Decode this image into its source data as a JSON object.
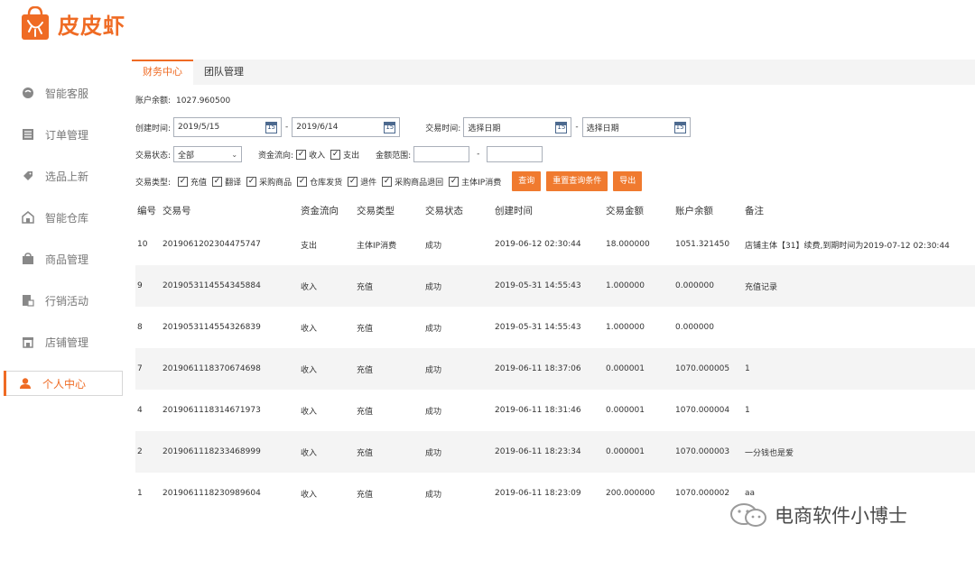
{
  "brand": {
    "name": "皮皮虾",
    "color": "#ef6b24"
  },
  "sidebar": {
    "items": [
      {
        "label": "智能客服",
        "icon": "chat-icon"
      },
      {
        "label": "订单管理",
        "icon": "list-icon"
      },
      {
        "label": "选品上新",
        "icon": "tag-icon"
      },
      {
        "label": "智能仓库",
        "icon": "warehouse-icon"
      },
      {
        "label": "商品管理",
        "icon": "bag-icon"
      },
      {
        "label": "行销活动",
        "icon": "activity-icon"
      },
      {
        "label": "店铺管理",
        "icon": "store-icon"
      },
      {
        "label": "个人中心",
        "icon": "user-icon",
        "active": true
      }
    ]
  },
  "tabs": [
    {
      "label": "财务中心",
      "active": true
    },
    {
      "label": "团队管理"
    }
  ],
  "account": {
    "label": "账户余额:",
    "value": "1027.960500"
  },
  "filters": {
    "created_label": "创建时间:",
    "created_from": "2019/5/15",
    "created_to": "2019/6/14",
    "trade_label": "交易时间:",
    "trade_from_placeholder": "选择日期",
    "trade_to_placeholder": "选择日期",
    "calendar_text": "15",
    "status_label": "交易状态:",
    "status_value": "全部",
    "flow_label": "资金流向:",
    "flow_in": "收入",
    "flow_out": "支出",
    "amount_label": "金额范围:",
    "dash": "-",
    "type_label": "交易类型:",
    "types": [
      "充值",
      "翻译",
      "采购商品",
      "仓库发货",
      "退件",
      "采购商品退回",
      "主体IP消费"
    ],
    "btn_query": "查询",
    "btn_reset": "重置查询条件",
    "btn_export": "导出"
  },
  "table": {
    "headers": [
      "编号",
      "交易号",
      "资金流向",
      "交易类型",
      "交易状态",
      "创建时间",
      "交易金额",
      "账户余额",
      "备注"
    ],
    "rows": [
      [
        "10",
        "2019061202304475747",
        "支出",
        "主体IP消费",
        "成功",
        "2019-06-12 02:30:44",
        "18.000000",
        "1051.321450",
        "店铺主体【31】续费,到期时间为2019-07-12 02:30:44"
      ],
      [
        "9",
        "2019053114554345884",
        "收入",
        "充值",
        "成功",
        "2019-05-31 14:55:43",
        "1.000000",
        "0.000000",
        "充值记录"
      ],
      [
        "8",
        "2019053114554326839",
        "收入",
        "充值",
        "成功",
        "2019-05-31 14:55:43",
        "1.000000",
        "0.000000",
        ""
      ],
      [
        "7",
        "2019061118370674698",
        "收入",
        "充值",
        "成功",
        "2019-06-11 18:37:06",
        "0.000001",
        "1070.000005",
        "1"
      ],
      [
        "4",
        "2019061118314671973",
        "收入",
        "充值",
        "成功",
        "2019-06-11 18:31:46",
        "0.000001",
        "1070.000004",
        "1"
      ],
      [
        "2",
        "2019061118233468999",
        "收入",
        "充值",
        "成功",
        "2019-06-11 18:23:34",
        "0.000001",
        "1070.000003",
        "一分钱也是爱"
      ],
      [
        "1",
        "2019061118230989604",
        "收入",
        "充值",
        "成功",
        "2019-06-11 18:23:09",
        "200.000000",
        "1070.000002",
        "aa"
      ]
    ]
  },
  "watermark": {
    "text": "电商软件小博士"
  }
}
